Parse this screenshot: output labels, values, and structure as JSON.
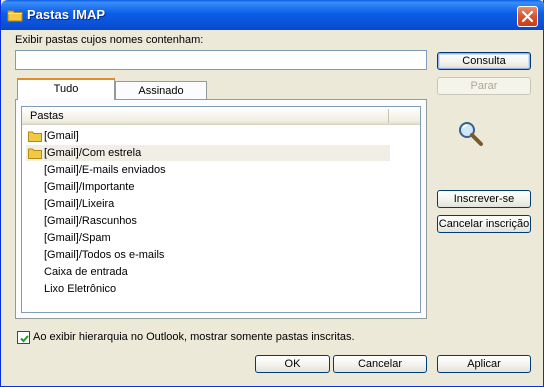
{
  "window": {
    "title": "Pastas IMAP",
    "folder_icon": "folder-icon",
    "close_icon": "close-icon"
  },
  "filter": {
    "label": "Exibir pastas cujos nomes contenham:",
    "value": "",
    "placeholder": ""
  },
  "buttons": {
    "consulta": "Consulta",
    "parar": "Parar",
    "inscrever": "Inscrever-se",
    "cancelar_inscricao": "Cancelar inscrição",
    "ok": "OK",
    "cancelar": "Cancelar",
    "aplicar": "Aplicar"
  },
  "tabs": [
    {
      "label": "Tudo",
      "active": true
    },
    {
      "label": "Assinado",
      "active": false
    }
  ],
  "list": {
    "column_header": "Pastas",
    "rows": [
      {
        "label": "[Gmail]",
        "icon": "folder-icon"
      },
      {
        "label": "[Gmail]/Com estrela",
        "icon": "folder-icon"
      },
      {
        "label": "[Gmail]/E-mails enviados",
        "icon": ""
      },
      {
        "label": "[Gmail]/Importante",
        "icon": ""
      },
      {
        "label": "[Gmail]/Lixeira",
        "icon": ""
      },
      {
        "label": "[Gmail]/Rascunhos",
        "icon": ""
      },
      {
        "label": "[Gmail]/Spam",
        "icon": ""
      },
      {
        "label": "[Gmail]/Todos os e-mails",
        "icon": ""
      },
      {
        "label": "Caixa de entrada",
        "icon": ""
      },
      {
        "label": "Lixo Eletrônico",
        "icon": ""
      }
    ]
  },
  "checkbox": {
    "label": "Ao exibir hierarquia no Outlook, mostrar somente pastas inscritas.",
    "checked": true
  },
  "colors": {
    "titlebar": "#0a5fe4",
    "dialog_bg": "#ece9d8",
    "active_tab_accent": "#e68b2c",
    "selected_row": "#f0eee5"
  }
}
